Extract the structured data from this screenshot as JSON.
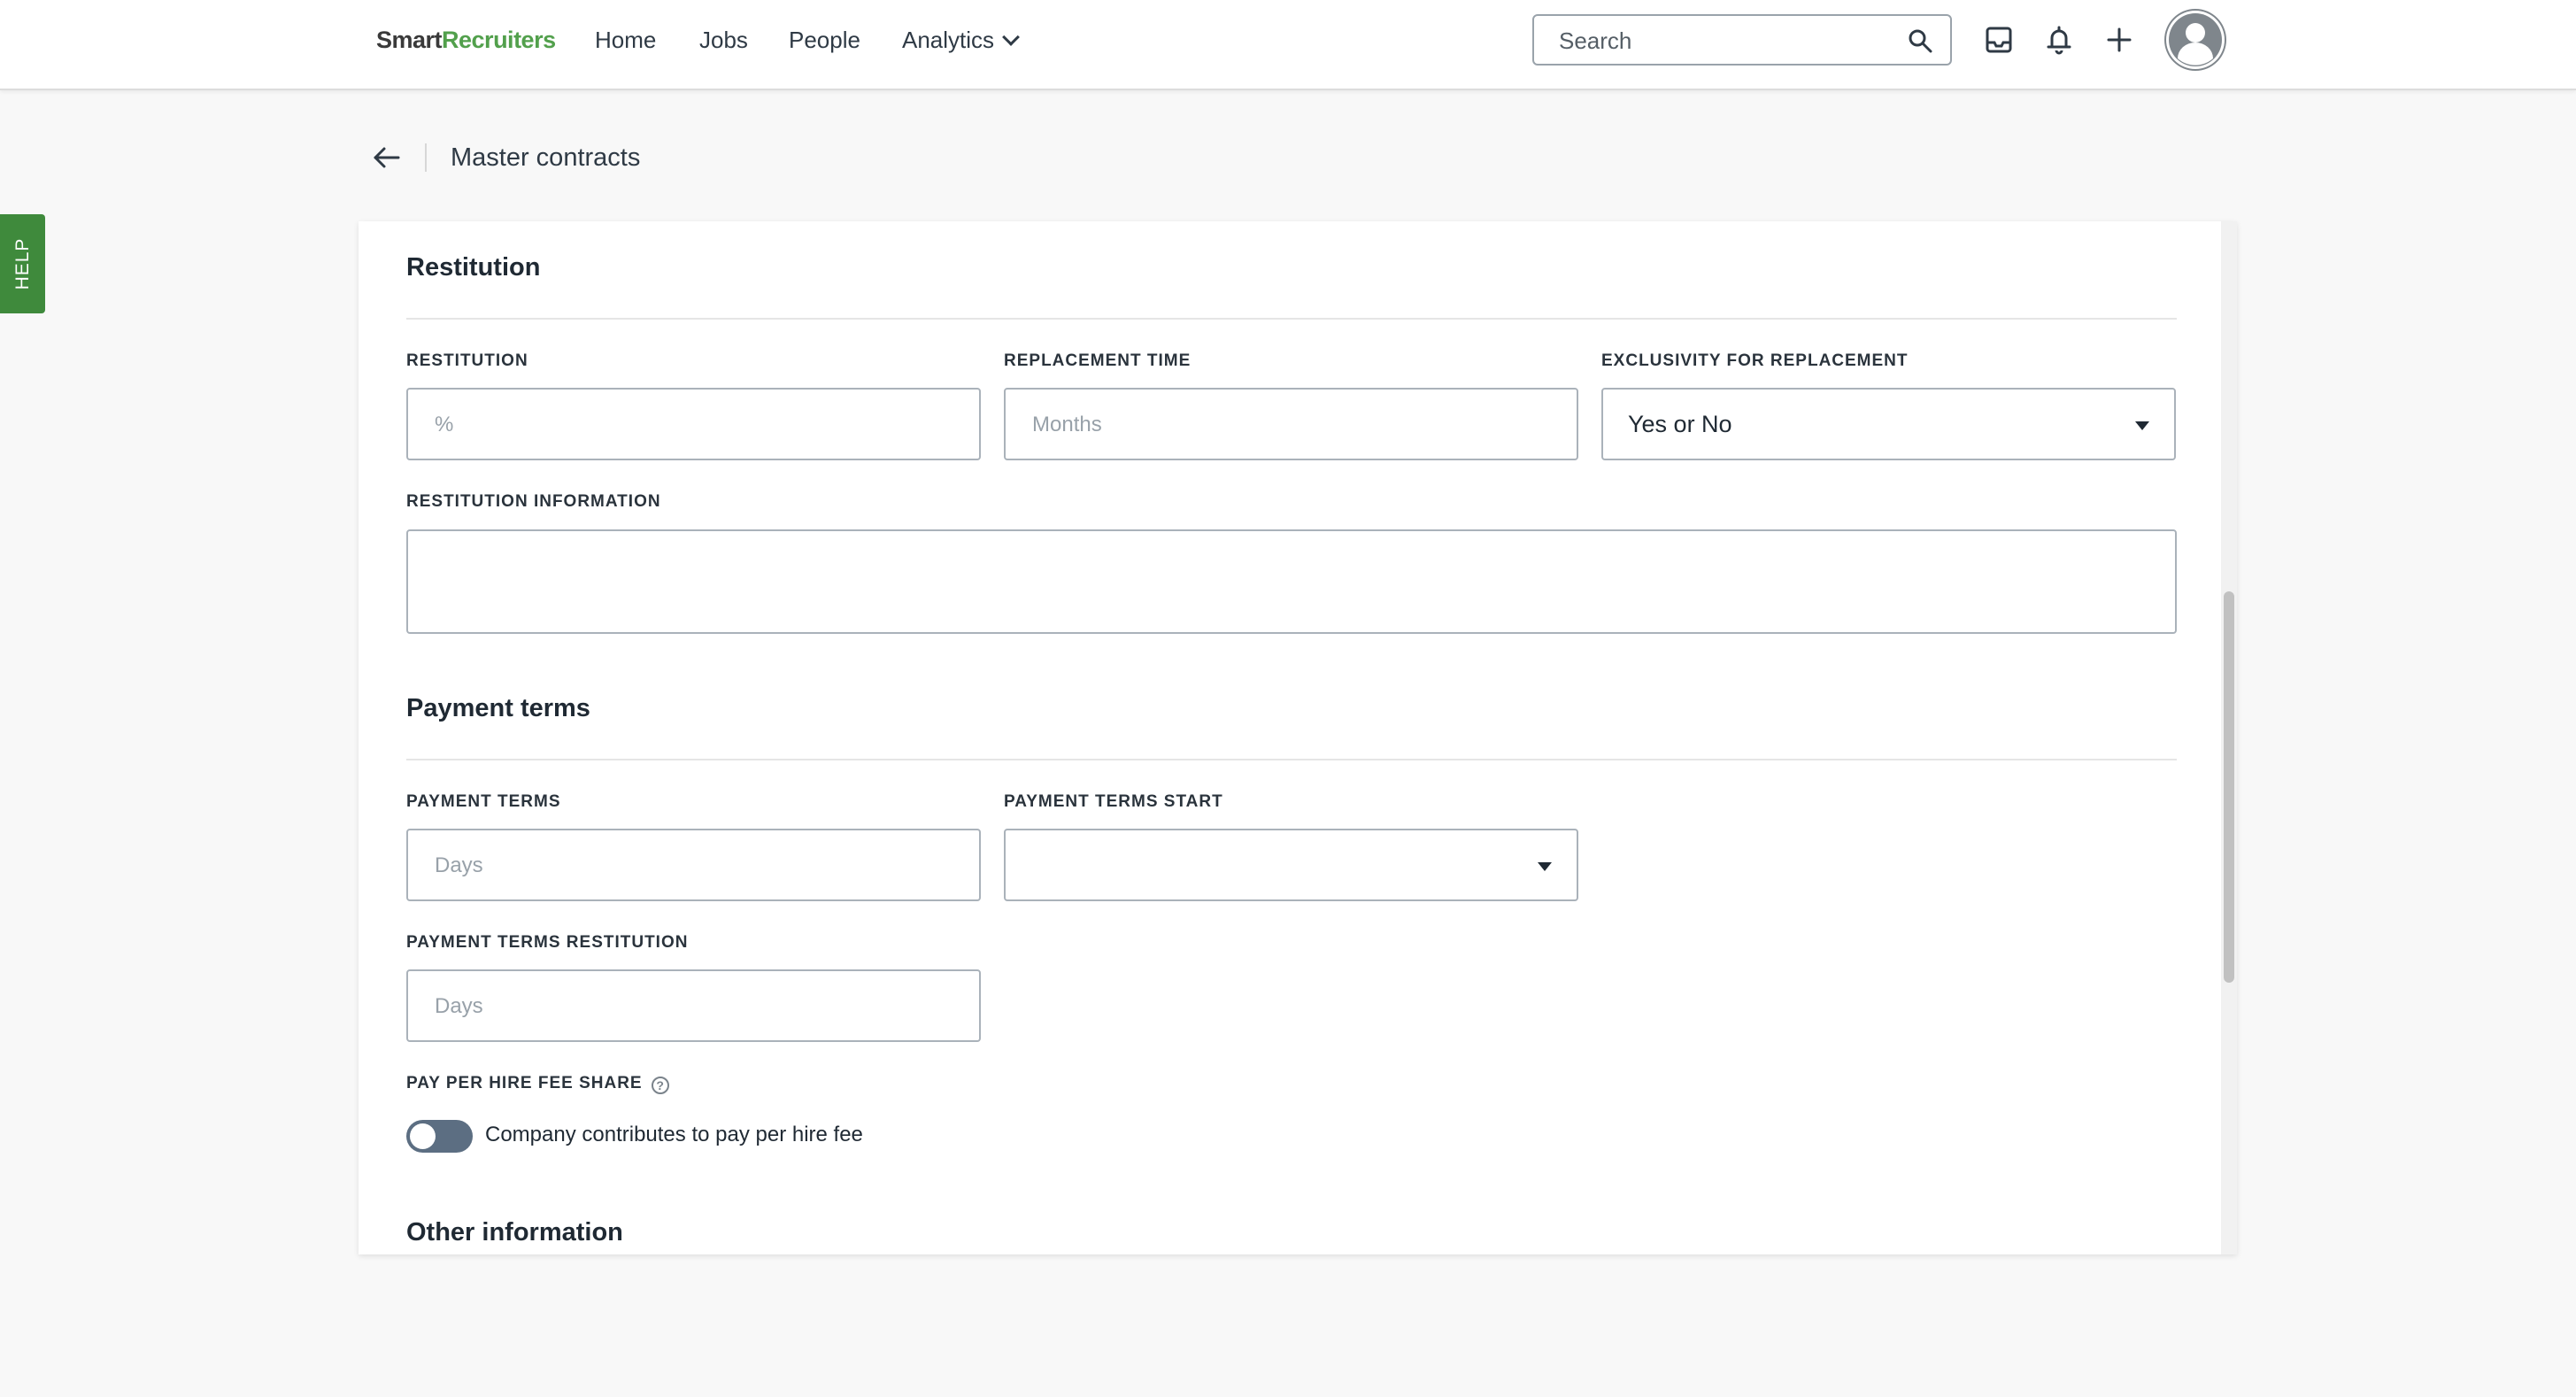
{
  "topbar": {
    "logo_smart": "Smart",
    "logo_recruiters": "Recruiters",
    "nav": {
      "home": "Home",
      "jobs": "Jobs",
      "people": "People",
      "analytics": "Analytics"
    },
    "search_placeholder": "Search"
  },
  "help_tab": {
    "label": "HELP"
  },
  "breadcrumb": {
    "title": "Master contracts"
  },
  "restitution_section": {
    "title": "Restitution",
    "restitution_label": "RESTITUTION",
    "restitution_placeholder": "%",
    "replacement_time_label": "REPLACEMENT TIME",
    "replacement_time_placeholder": "Months",
    "exclusivity_label": "EXCLUSIVITY FOR REPLACEMENT",
    "exclusivity_value": "Yes or No",
    "info_label": "RESTITUTION INFORMATION"
  },
  "payment_section": {
    "title": "Payment terms",
    "terms_label": "PAYMENT TERMS",
    "terms_placeholder": "Days",
    "terms_start_label": "PAYMENT TERMS START",
    "terms_start_value": "",
    "terms_restitution_label": "PAYMENT TERMS RESTITUTION",
    "terms_restitution_placeholder": "Days",
    "fee_share_label": "PAY PER HIRE FEE SHARE",
    "fee_share_help": "?",
    "toggle_label": "Company contributes to pay per hire fee",
    "toggle_on": false
  },
  "other_section": {
    "title": "Other information"
  },
  "colors": {
    "brand_green": "#52a04c",
    "help_tab": "#3f8a3c",
    "toggle_off": "#5c6e82"
  }
}
